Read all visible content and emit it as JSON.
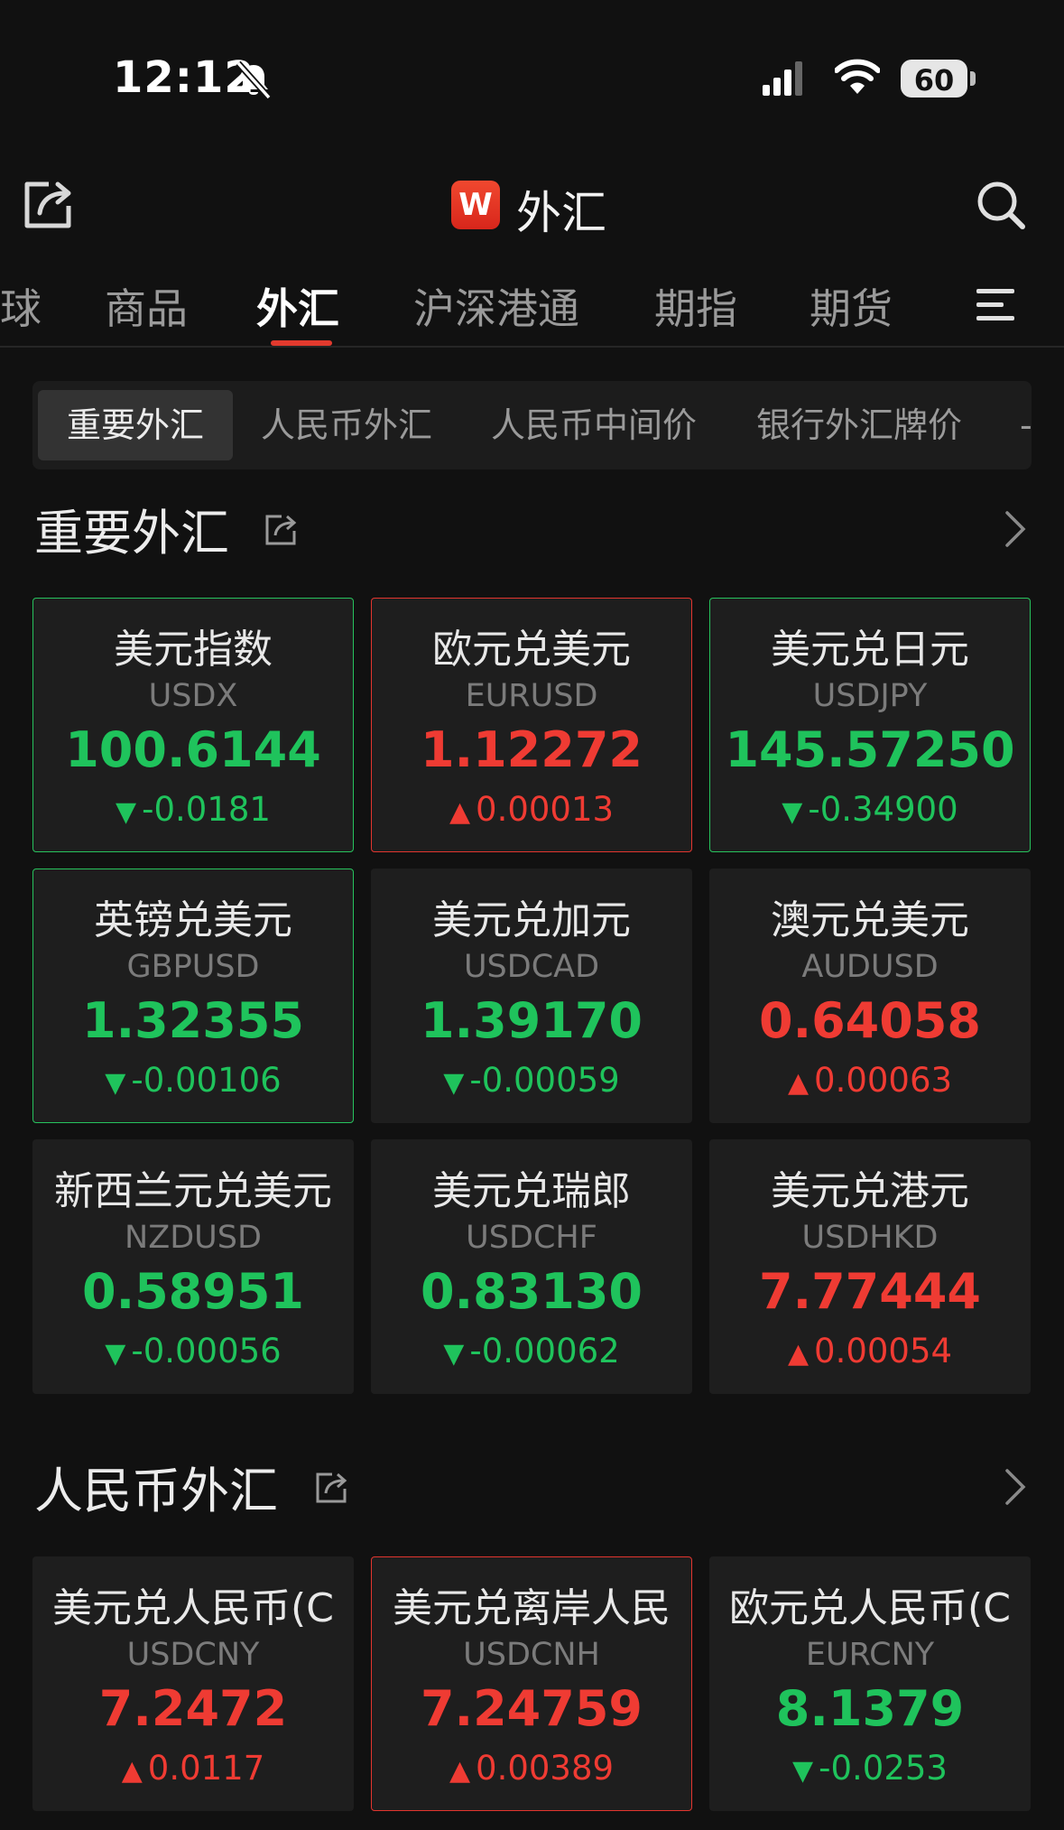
{
  "status_bar": {
    "time": "12:12",
    "battery": "60"
  },
  "nav": {
    "title": "外汇",
    "logo_letter": "W"
  },
  "tabs": [
    "球",
    "商品",
    "外汇",
    "沪深港通",
    "期指",
    "期货"
  ],
  "segments": [
    "重要外汇",
    "人民币外汇",
    "人民币中间价",
    "银行外汇牌价",
    "-"
  ],
  "sections": [
    {
      "title": "重要外汇",
      "cards": [
        {
          "name": "美元指数",
          "code": "USDX",
          "price": "100.6144",
          "change": "-0.0181",
          "dir": "down",
          "bordered": true
        },
        {
          "name": "欧元兑美元",
          "code": "EURUSD",
          "price": "1.12272",
          "change": "0.00013",
          "dir": "up",
          "bordered": true
        },
        {
          "name": "美元兑日元",
          "code": "USDJPY",
          "price": "145.57250",
          "change": "-0.34900",
          "dir": "down",
          "bordered": true
        },
        {
          "name": "英镑兑美元",
          "code": "GBPUSD",
          "price": "1.32355",
          "change": "-0.00106",
          "dir": "down",
          "bordered": true
        },
        {
          "name": "美元兑加元",
          "code": "USDCAD",
          "price": "1.39170",
          "change": "-0.00059",
          "dir": "down",
          "bordered": false
        },
        {
          "name": "澳元兑美元",
          "code": "AUDUSD",
          "price": "0.64058",
          "change": "0.00063",
          "dir": "up",
          "bordered": false
        },
        {
          "name": "新西兰元兑美元",
          "code": "NZDUSD",
          "price": "0.58951",
          "change": "-0.00056",
          "dir": "down",
          "bordered": false
        },
        {
          "name": "美元兑瑞郎",
          "code": "USDCHF",
          "price": "0.83130",
          "change": "-0.00062",
          "dir": "down",
          "bordered": false
        },
        {
          "name": "美元兑港元",
          "code": "USDHKD",
          "price": "7.77444",
          "change": "0.00054",
          "dir": "up",
          "bordered": false
        }
      ]
    },
    {
      "title": "人民币外汇",
      "cards": [
        {
          "name": "美元兑人民币(C",
          "code": "USDCNY",
          "price": "7.2472",
          "change": "0.0117",
          "dir": "up",
          "bordered": false
        },
        {
          "name": "美元兑离岸人民",
          "code": "USDCNH",
          "price": "7.24759",
          "change": "0.00389",
          "dir": "up",
          "bordered": true
        },
        {
          "name": "欧元兑人民币(C",
          "code": "EURCNY",
          "price": "8.1379",
          "change": "-0.0253",
          "dir": "down",
          "bordered": false
        }
      ]
    }
  ]
}
